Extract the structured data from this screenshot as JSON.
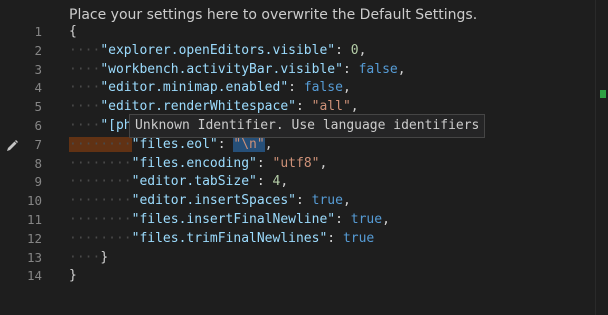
{
  "editor": {
    "hint": "Place your settings here to overwrite the Default Settings.",
    "tooltip": "Unknown Identifier. Use language identifiers",
    "lines": [
      {
        "n": "1",
        "indent": "",
        "segments": [
          {
            "c": "pun",
            "t": "{"
          }
        ]
      },
      {
        "n": "2",
        "indent": "····",
        "segments": [
          {
            "c": "key",
            "t": "\"explorer.openEditors.visible\""
          },
          {
            "c": "pun",
            "t": ": "
          },
          {
            "c": "num",
            "t": "0"
          },
          {
            "c": "pun",
            "t": ","
          }
        ]
      },
      {
        "n": "3",
        "indent": "····",
        "segments": [
          {
            "c": "key",
            "t": "\"workbench.activityBar.visible\""
          },
          {
            "c": "pun",
            "t": ": "
          },
          {
            "c": "kw",
            "t": "false"
          },
          {
            "c": "pun",
            "t": ","
          }
        ]
      },
      {
        "n": "4",
        "indent": "····",
        "segments": [
          {
            "c": "key",
            "t": "\"editor.minimap.enabled\""
          },
          {
            "c": "pun",
            "t": ": "
          },
          {
            "c": "kw",
            "t": "false"
          },
          {
            "c": "pun",
            "t": ","
          }
        ]
      },
      {
        "n": "5",
        "indent": "····",
        "segments": [
          {
            "c": "key",
            "t": "\"editor.renderWhitespace\""
          },
          {
            "c": "pun",
            "t": ": "
          },
          {
            "c": "str",
            "t": "\"all\""
          },
          {
            "c": "pun",
            "t": ","
          }
        ]
      },
      {
        "n": "6",
        "indent": "····",
        "segments": [
          {
            "c": "key",
            "t": "\"[php]\""
          },
          {
            "c": "pun",
            "t": ": {"
          }
        ]
      },
      {
        "n": "7",
        "indent": "········",
        "segments": [
          {
            "c": "key",
            "t": "\"files.eol\""
          },
          {
            "c": "pun",
            "t": ": "
          },
          {
            "c": "str hl",
            "t": "\"\\n\""
          },
          {
            "c": "pun",
            "t": ","
          }
        ]
      },
      {
        "n": "8",
        "indent": "········",
        "segments": [
          {
            "c": "key",
            "t": "\"files.encoding\""
          },
          {
            "c": "pun",
            "t": ": "
          },
          {
            "c": "str",
            "t": "\"utf8\""
          },
          {
            "c": "pun",
            "t": ","
          }
        ]
      },
      {
        "n": "9",
        "indent": "········",
        "segments": [
          {
            "c": "key",
            "t": "\"editor.tabSize\""
          },
          {
            "c": "pun",
            "t": ": "
          },
          {
            "c": "num",
            "t": "4"
          },
          {
            "c": "pun",
            "t": ","
          }
        ]
      },
      {
        "n": "10",
        "indent": "········",
        "segments": [
          {
            "c": "key",
            "t": "\"editor.insertSpaces\""
          },
          {
            "c": "pun",
            "t": ": "
          },
          {
            "c": "kw",
            "t": "true"
          },
          {
            "c": "pun",
            "t": ","
          }
        ]
      },
      {
        "n": "11",
        "indent": "········",
        "segments": [
          {
            "c": "key",
            "t": "\"files.insertFinalNewline\""
          },
          {
            "c": "pun",
            "t": ": "
          },
          {
            "c": "kw",
            "t": "true"
          },
          {
            "c": "pun",
            "t": ","
          }
        ]
      },
      {
        "n": "12",
        "indent": "········",
        "segments": [
          {
            "c": "key",
            "t": "\"files.trimFinalNewlines\""
          },
          {
            "c": "pun",
            "t": ": "
          },
          {
            "c": "kw",
            "t": "true"
          }
        ]
      },
      {
        "n": "13",
        "indent": "····",
        "segments": [
          {
            "c": "pun",
            "t": "}"
          }
        ]
      },
      {
        "n": "14",
        "indent": "",
        "segments": [
          {
            "c": "pun",
            "t": "}"
          }
        ]
      }
    ]
  },
  "colors": {
    "background": "#1e1e1e",
    "key": "#9cdcfe",
    "string": "#ce9178",
    "number": "#b5cea8",
    "keyword": "#569cd6",
    "selection": "#264f78",
    "scroll_marker": "#2ea043"
  },
  "icons": {
    "edit": "pencil-icon"
  }
}
